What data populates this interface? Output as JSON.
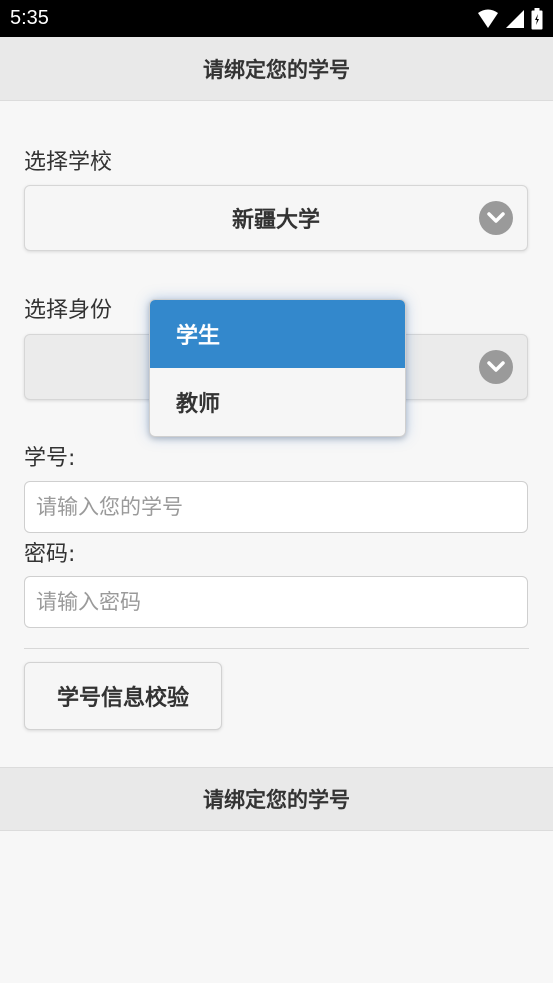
{
  "status_bar": {
    "time": "5:35"
  },
  "header": {
    "title": "请绑定您的学号"
  },
  "school": {
    "label": "选择学校",
    "selected": "新疆大学"
  },
  "identity": {
    "label": "选择身份",
    "selected": "",
    "options": [
      {
        "label": "学生",
        "active": true
      },
      {
        "label": "教师",
        "active": false
      }
    ]
  },
  "student_id": {
    "label": "学号:",
    "placeholder": "请输入您的学号"
  },
  "password": {
    "label": "密码:",
    "placeholder": "请输入密码"
  },
  "verify_button": {
    "label": "学号信息校验"
  },
  "footer": {
    "title": "请绑定您的学号"
  },
  "colors": {
    "accent": "#3388cc",
    "header_bg": "#e9e9e9",
    "status_bar": "#000000"
  }
}
